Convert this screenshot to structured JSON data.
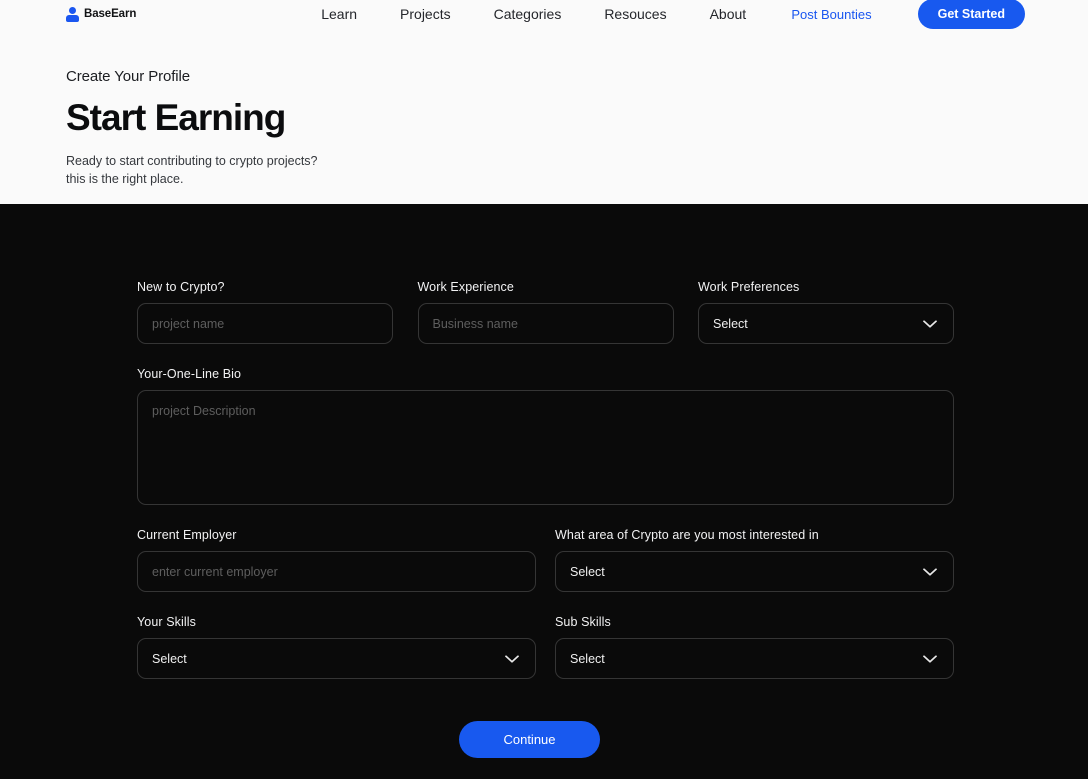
{
  "header": {
    "brand": {
      "name": "BaseEarn",
      "icon": "person-avatar-icon",
      "color": "#1a56f0"
    },
    "nav_links": [
      {
        "label": "Learn"
      },
      {
        "label": "Projects"
      },
      {
        "label": "Categories"
      },
      {
        "label": "Resouces"
      },
      {
        "label": "About"
      }
    ],
    "post_bounties_label": "Post Bounties",
    "get_started_label": "Get Started",
    "accent_color": "#1859ef"
  },
  "hero": {
    "eyebrow": "Create Your Profile",
    "title": "Start Earning",
    "subtitle_line_1": "Ready to start contributing to crypto projects?",
    "subtitle_line_2": "this is the right place.",
    "background_color": "#fafafa"
  },
  "form": {
    "background_color": "#0a0a0a",
    "row1": {
      "new_to_crypto": {
        "label": "New to Crypto?",
        "placeholder": "project name",
        "value": ""
      },
      "work_experience": {
        "label": "Work Experience",
        "placeholder": "Business name",
        "value": ""
      },
      "work_preferences": {
        "label": "Work Preferences",
        "selected": "Select",
        "icon": "chevron-down-icon"
      }
    },
    "bio": {
      "label": "Your-One-Line Bio",
      "placeholder": "project Description",
      "value": ""
    },
    "row3": {
      "current_employer": {
        "label": "Current Employer",
        "placeholder": "enter current employer",
        "value": ""
      },
      "crypto_area": {
        "label": "What area of Crypto are you most interested in",
        "selected": "Select",
        "icon": "chevron-down-icon"
      }
    },
    "row4": {
      "your_skills": {
        "label": "Your Skills",
        "selected": "Select",
        "icon": "chevron-down-icon"
      },
      "sub_skills": {
        "label": "Sub Skills",
        "selected": "Select",
        "icon": "chevron-down-icon"
      }
    },
    "continue_label": "Continue"
  }
}
